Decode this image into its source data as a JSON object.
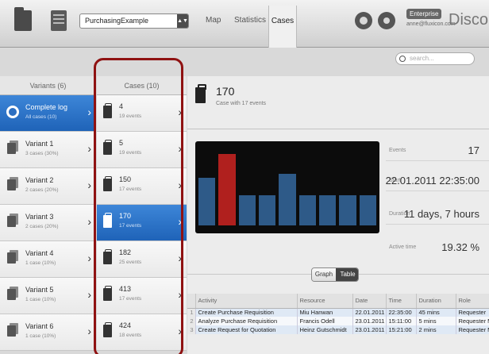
{
  "toolbar": {
    "dataset": "PurchasingExample",
    "tabs": [
      "Map",
      "Statistics",
      "Cases"
    ],
    "active_tab": "Cases",
    "edition": "Enterprise",
    "user": "anne@fluxicon.com",
    "app_title": "Disco"
  },
  "search": {
    "placeholder": "search..."
  },
  "variants": {
    "header": "Variants (6)",
    "items": [
      {
        "title": "Complete log",
        "sub": "All cases (10)"
      },
      {
        "title": "Variant 1",
        "sub": "3 cases (30%)"
      },
      {
        "title": "Variant 2",
        "sub": "2 cases (20%)"
      },
      {
        "title": "Variant 3",
        "sub": "2 cases (20%)"
      },
      {
        "title": "Variant 4",
        "sub": "1 case (10%)"
      },
      {
        "title": "Variant 5",
        "sub": "1 case (10%)"
      },
      {
        "title": "Variant 6",
        "sub": "1 case (10%)"
      }
    ]
  },
  "cases": {
    "header": "Cases (10)",
    "items": [
      {
        "title": "4",
        "sub": "19 events"
      },
      {
        "title": "5",
        "sub": "19 events"
      },
      {
        "title": "150",
        "sub": "17 events"
      },
      {
        "title": "170",
        "sub": "17 events"
      },
      {
        "title": "182",
        "sub": "25 events"
      },
      {
        "title": "413",
        "sub": "17 events"
      },
      {
        "title": "424",
        "sub": "18 events"
      }
    ]
  },
  "detail": {
    "title": "170",
    "subtitle": "Case with 17 events",
    "stats": [
      {
        "label": "Events",
        "value": "17"
      },
      {
        "label": "Start",
        "value": "22.01.2011 22:35:00"
      },
      {
        "label": "Duration",
        "value": "11 days, 7 hours"
      },
      {
        "label": "Active time",
        "value": "19.32 %"
      }
    ],
    "view_toggle": {
      "graph": "Graph",
      "table": "Table",
      "active": "Table"
    }
  },
  "colors": {
    "selected": "#2e74c9",
    "highlight_bar": "#b0201e",
    "bar": "#2e5a88",
    "outline": "#8f1212"
  },
  "chart_data": {
    "type": "bar",
    "title": "",
    "bars": [
      {
        "value": 0.62,
        "active": false
      },
      {
        "value": 0.94,
        "active": true
      },
      {
        "value": 0.4,
        "active": false
      },
      {
        "value": 0.4,
        "active": false
      },
      {
        "value": 0.68,
        "active": false
      },
      {
        "value": 0.4,
        "active": false
      },
      {
        "value": 0.4,
        "active": false
      },
      {
        "value": 0.4,
        "active": false
      },
      {
        "value": 0.4,
        "active": false
      }
    ]
  },
  "table": {
    "columns": [
      "Activity",
      "Resource",
      "Date",
      "Time",
      "Duration",
      "Role"
    ],
    "rows": [
      [
        "1",
        "Create Purchase Requisition",
        "Miu Hanwan",
        "22.01.2011",
        "22:35:00",
        "45 mins",
        "Requester"
      ],
      [
        "2",
        "Analyze Purchase Requisition",
        "Francis Odell",
        "23.01.2011",
        "15:11:00",
        "5 mins",
        "Requester Manager"
      ],
      [
        "3",
        "Create Request for Quotation",
        "Heinz Gutschmidt",
        "23.01.2011",
        "15:21:00",
        "2 mins",
        "Requester Manager"
      ]
    ]
  }
}
